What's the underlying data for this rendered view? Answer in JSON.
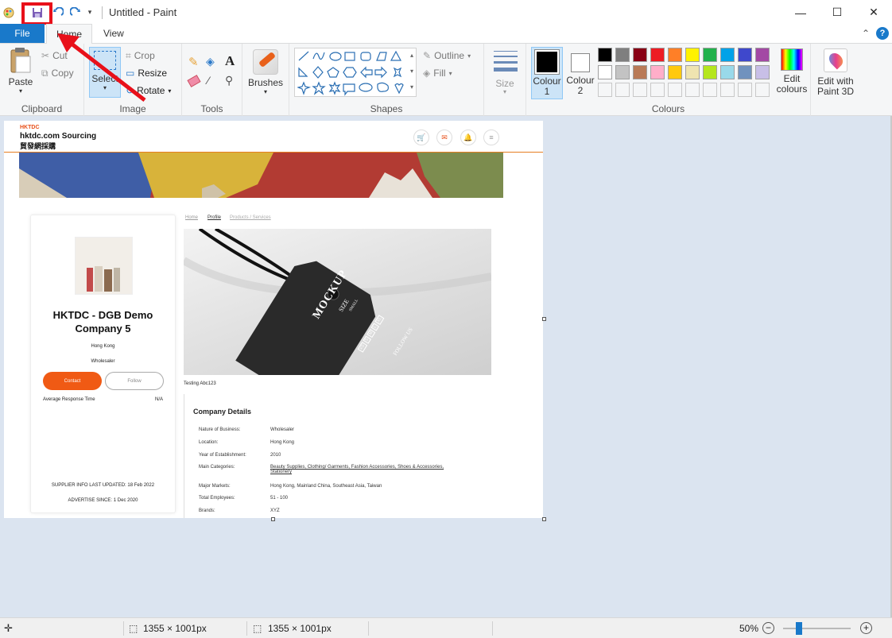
{
  "window": {
    "title": "Untitled - Paint"
  },
  "tabs": {
    "file": "File",
    "home": "Home",
    "view": "View"
  },
  "ribbon": {
    "clipboard": {
      "label": "Clipboard",
      "paste": "Paste",
      "cut": "Cut",
      "copy": "Copy"
    },
    "image": {
      "label": "Image",
      "select": "Select",
      "crop": "Crop",
      "resize": "Resize",
      "rotate": "Rotate"
    },
    "tools": {
      "label": "Tools"
    },
    "brushes": {
      "label": "Brushes"
    },
    "shapes": {
      "label": "Shapes",
      "outline": "Outline",
      "fill": "Fill"
    },
    "size": {
      "label": "Size"
    },
    "colours": {
      "label": "Colours",
      "colour1": "Colour 1",
      "colour2": "Colour 2",
      "edit_colours": "Edit colours",
      "palette_row1": [
        "#000000",
        "#7f7f7f",
        "#880015",
        "#ed1c24",
        "#ff7f27",
        "#fff200",
        "#22b14c",
        "#00a2e8",
        "#3f48cc",
        "#a349a4"
      ],
      "palette_row2": [
        "#ffffff",
        "#c3c3c3",
        "#b97a57",
        "#ffaec9",
        "#ffc90e",
        "#efe4b0",
        "#b5e61d",
        "#99d9ea",
        "#7092be",
        "#c8bfe7"
      ]
    },
    "paint3d": "Edit with Paint 3D"
  },
  "status": {
    "selection_size": "1355 × 1001px",
    "image_size": "1355 × 1001px",
    "zoom": "50%"
  },
  "webpage": {
    "logo_small": "HKTDC",
    "logo_main": "hktdc.com Sourcing",
    "logo_sub": "貿發網採購",
    "breadcrumb": [
      "Home",
      "Profile",
      "Products / Services"
    ],
    "company_name": "HKTDC - DGB Demo Company 5",
    "location": "Hong Kong",
    "business_type": "Wholesaler",
    "contact": "Contact",
    "follow": "Follow",
    "avg_response_label": "Average Response Time",
    "avg_response_value": "N/A",
    "supplier_updated": "SUPPLIER INFO LAST UPDATED: 18 Feb 2022",
    "advertise_since": "ADVERTISE SINCE: 1 Dec 2020",
    "caption": "Testing Abc123",
    "details_title": "Company Details",
    "details": [
      {
        "label": "Nature of Business:",
        "value": "Wholesaler"
      },
      {
        "label": "Location:",
        "value": "Hong Kong"
      },
      {
        "label": "Year of Establishment:",
        "value": "2010"
      },
      {
        "label": "Main Categories:",
        "value": "Beauty Supplies, Clothing/ Garments, Fashion Accessories, Shoes & Accessories, Stationery"
      },
      {
        "label": "Major Markets:",
        "value": "Hong Kong, Mainland China, Southeast Asia, Taiwan"
      },
      {
        "label": "Total Employees:",
        "value": "51 - 100"
      },
      {
        "label": "Brands:",
        "value": "XYZ"
      }
    ],
    "tag": {
      "brand": "MOCKUP",
      "size": "SIZE",
      "size_sub": "SMALL",
      "sizes": [
        "XS",
        "S",
        "M",
        "L",
        "XL"
      ],
      "follow": "FOLLOW US"
    }
  }
}
